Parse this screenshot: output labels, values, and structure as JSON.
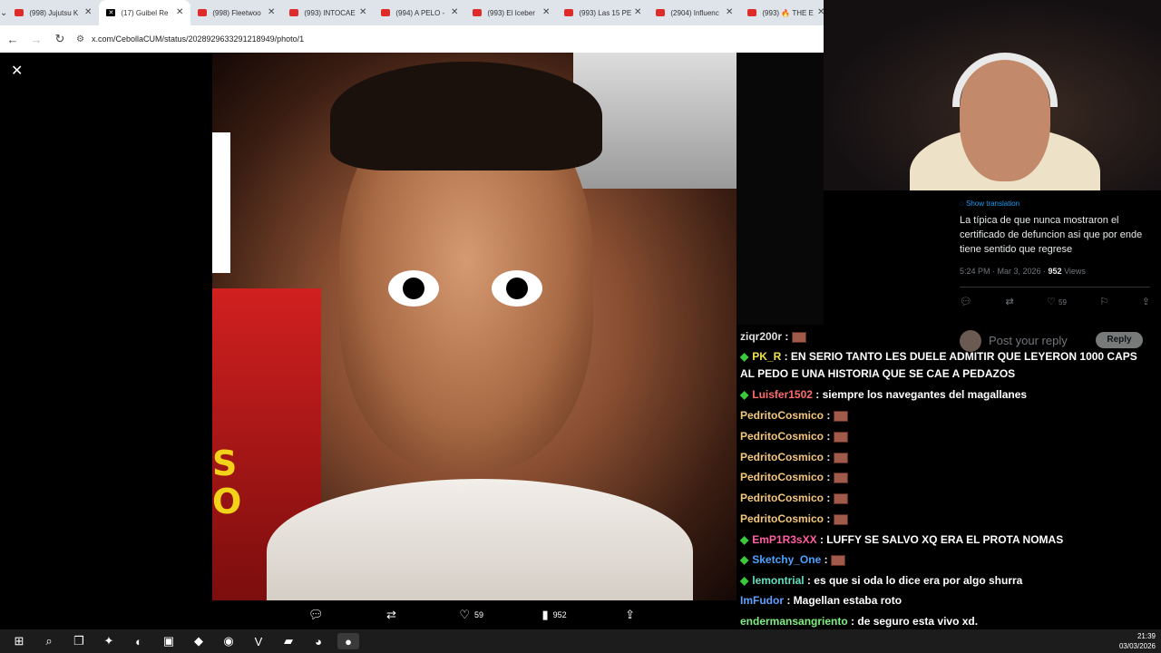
{
  "browser": {
    "tabs": [
      {
        "title": "(998) Jujutsu K",
        "favicon": "youtube-icon",
        "active": false
      },
      {
        "title": "(17) Guibel Re",
        "favicon": "x-icon",
        "active": true
      },
      {
        "title": "(998) Fleetwoo",
        "favicon": "youtube-icon",
        "active": false
      },
      {
        "title": "(993) INTOCAE",
        "favicon": "youtube-icon",
        "active": false
      },
      {
        "title": "(994) A PELO -",
        "favicon": "youtube-icon",
        "active": false
      },
      {
        "title": "(993) El Iceber",
        "favicon": "youtube-icon",
        "active": false
      },
      {
        "title": "(993) Las 15 PE",
        "favicon": "youtube-icon",
        "active": false
      },
      {
        "title": "(2904) Influenc",
        "favicon": "youtube-icon",
        "active": false
      },
      {
        "title": "(993) 🔥 THE E",
        "favicon": "youtube-icon",
        "active": false
      }
    ],
    "url": "x.com/CebollaCUM/status/2028929633291218949/photo/1"
  },
  "viewer": {
    "photo_text": "S\nO",
    "actions": {
      "reply_count": "",
      "repost_count": "",
      "like_count": "59",
      "views_count": "952"
    }
  },
  "tweet": {
    "show_translation": "Show translation",
    "body": "La típica de que nunca mostraron el certificado de defuncion asi que por ende tiene sentido que regrese",
    "timestamp": "5:24 PM · Mar 3, 2026 · ",
    "views": "952",
    "views_label": " Views",
    "like_count": "59",
    "reply_placeholder": "Post your reply",
    "reply_button": "Reply"
  },
  "chat": {
    "messages": [
      {
        "user": "ziqr200r",
        "color": "#e0e0e0",
        "text": "",
        "emote": true,
        "badge": false
      },
      {
        "user": "PK_R",
        "color": "#f0e04a",
        "text": "EN SERIO TANTO LES DUELE ADMITIR QUE LEYERON 1000 CAPS AL PEDO E UNA HISTORIA QUE SE CAE A PEDAZOS",
        "emote": false,
        "badge": true
      },
      {
        "user": "Luisfer1502",
        "color": "#ff6a6a",
        "text": "siempre los navegantes del magallanes",
        "emote": false,
        "badge": true
      },
      {
        "user": "PedritoCosmico",
        "color": "#f5c77a",
        "text": "",
        "emote": true,
        "badge": false
      },
      {
        "user": "PedritoCosmico",
        "color": "#f5c77a",
        "text": "",
        "emote": true,
        "badge": false
      },
      {
        "user": "PedritoCosmico",
        "color": "#f5c77a",
        "text": "",
        "emote": true,
        "badge": false
      },
      {
        "user": "PedritoCosmico",
        "color": "#f5c77a",
        "text": "",
        "emote": true,
        "badge": false
      },
      {
        "user": "PedritoCosmico",
        "color": "#f5c77a",
        "text": "",
        "emote": true,
        "badge": false
      },
      {
        "user": "PedritoCosmico",
        "color": "#f5c77a",
        "text": "",
        "emote": true,
        "badge": false
      },
      {
        "user": "EmP1R3sXX",
        "color": "#ff5fa0",
        "text": "LUFFY SE SALVO XQ ERA EL PROTA NOMAS",
        "emote": false,
        "badge": true
      },
      {
        "user": "Sketchy_One",
        "color": "#4aa3ff",
        "text": "",
        "emote": true,
        "badge": true
      },
      {
        "user": "lemontrial",
        "color": "#5fe0c0",
        "text": "es que si oda lo dice era por algo shurra",
        "emote": false,
        "badge": true
      },
      {
        "user": "ImFudor",
        "color": "#5fa0ff",
        "text": "Magellan estaba roto",
        "emote": false,
        "badge": false
      },
      {
        "user": "endermansangriento",
        "color": "#7ff07f",
        "text": "de seguro esta vivo xd.",
        "emote": false,
        "badge": false
      }
    ]
  },
  "taskbar": {
    "time": "21:39",
    "date": "03/03/2026"
  }
}
